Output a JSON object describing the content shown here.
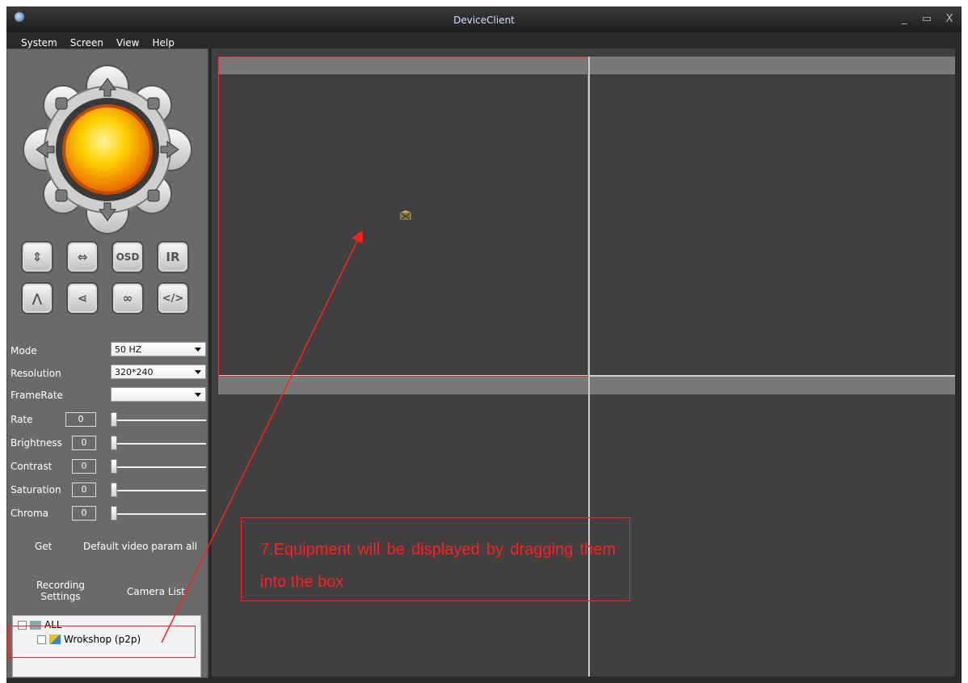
{
  "window": {
    "title": "DeviceClient",
    "controls": [
      "_",
      "▭",
      "X"
    ]
  },
  "menu": [
    "System",
    "Screen",
    "View",
    "Help"
  ],
  "ptz": {
    "directions": [
      "up-icon",
      "up-right-icon",
      "right-icon",
      "down-right-icon",
      "down-icon",
      "down-left-icon",
      "left-icon",
      "up-left-icon"
    ],
    "buttons_row1": [
      "⇕",
      "⇔",
      "OSD",
      "IR"
    ],
    "buttons_row2": [
      "⋀",
      "⋖",
      "∞",
      "</>"
    ]
  },
  "params": {
    "mode_label": "Mode",
    "mode_value": "50 HZ",
    "resolution_label": "Resolution",
    "resolution_value": "320*240",
    "framerate_label": "FrameRate",
    "framerate_value": "",
    "rate_label": "Rate",
    "rate_value": "0",
    "brightness_label": "Brightness",
    "brightness_value": "0",
    "contrast_label": "Contrast",
    "contrast_value": "0",
    "saturation_label": "Saturation",
    "saturation_value": "0",
    "chroma_label": "Chroma",
    "chroma_value": "0"
  },
  "actions": {
    "get": "Get",
    "default": "Default video param all"
  },
  "tabs": {
    "recording": "Recording\nSettings",
    "camera_list": "Camera List"
  },
  "tree": {
    "root": "ALL",
    "items": [
      "Wrokshop (p2p)"
    ]
  },
  "annotation": {
    "text": "7.Equipment will be displayed by dragging them into the box",
    "color": "#ff2020"
  }
}
